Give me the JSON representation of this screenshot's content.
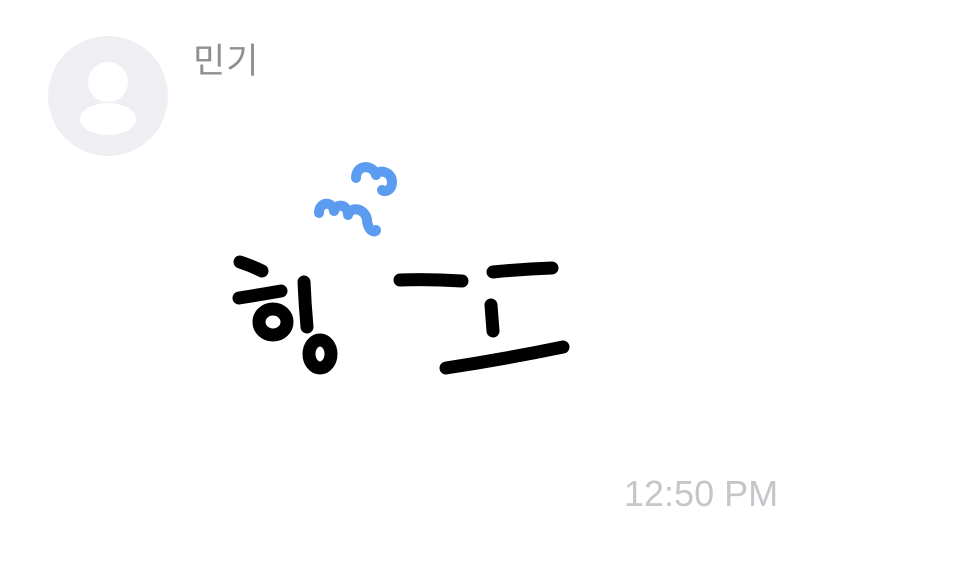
{
  "message": {
    "sender_name": "민기",
    "timestamp": "12:50 PM",
    "avatar_icon": "person-placeholder-icon",
    "sticker_icon": "handwritten-sticker-icon"
  },
  "colors": {
    "avatar_bg": "#efeff3",
    "avatar_glyph": "#ffffff",
    "ink": "#000000",
    "accent": "#5b9cf0",
    "sender_text": "#8e8e93",
    "timestamp_text": "#c5c5ca"
  }
}
